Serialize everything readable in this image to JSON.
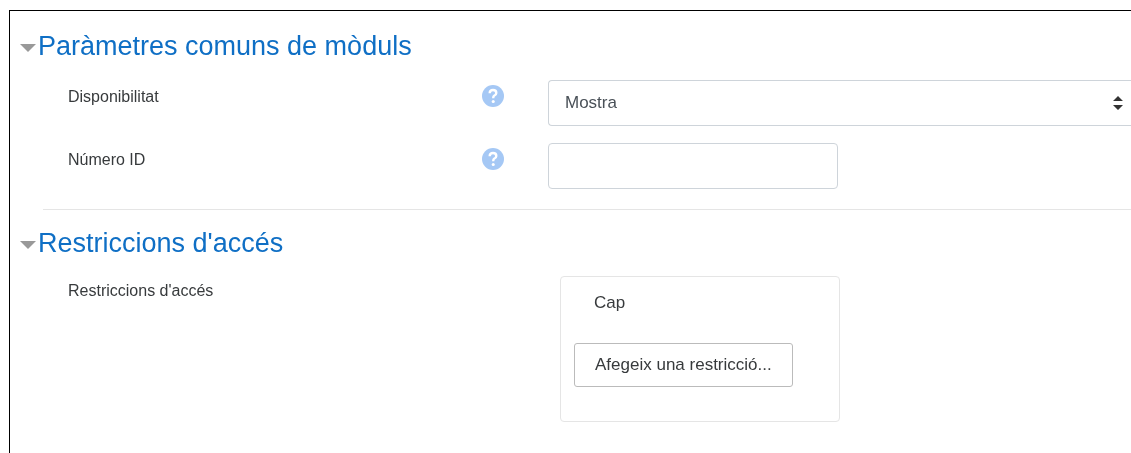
{
  "sections": [
    {
      "title": "Paràmetres comuns de mòduls",
      "expanded": true,
      "fields": [
        {
          "kind": "select",
          "label": "Disponibilitat",
          "help": true,
          "value": "Mostra"
        },
        {
          "kind": "text",
          "label": "Número ID",
          "help": true
        }
      ]
    },
    {
      "title": "Restriccions d'accés",
      "expanded": true,
      "fields": [
        {
          "kind": "restrictions",
          "label": "Restriccions d'accés",
          "help": false,
          "status": "Cap",
          "button": "Afegeix una restricció..."
        }
      ]
    }
  ]
}
